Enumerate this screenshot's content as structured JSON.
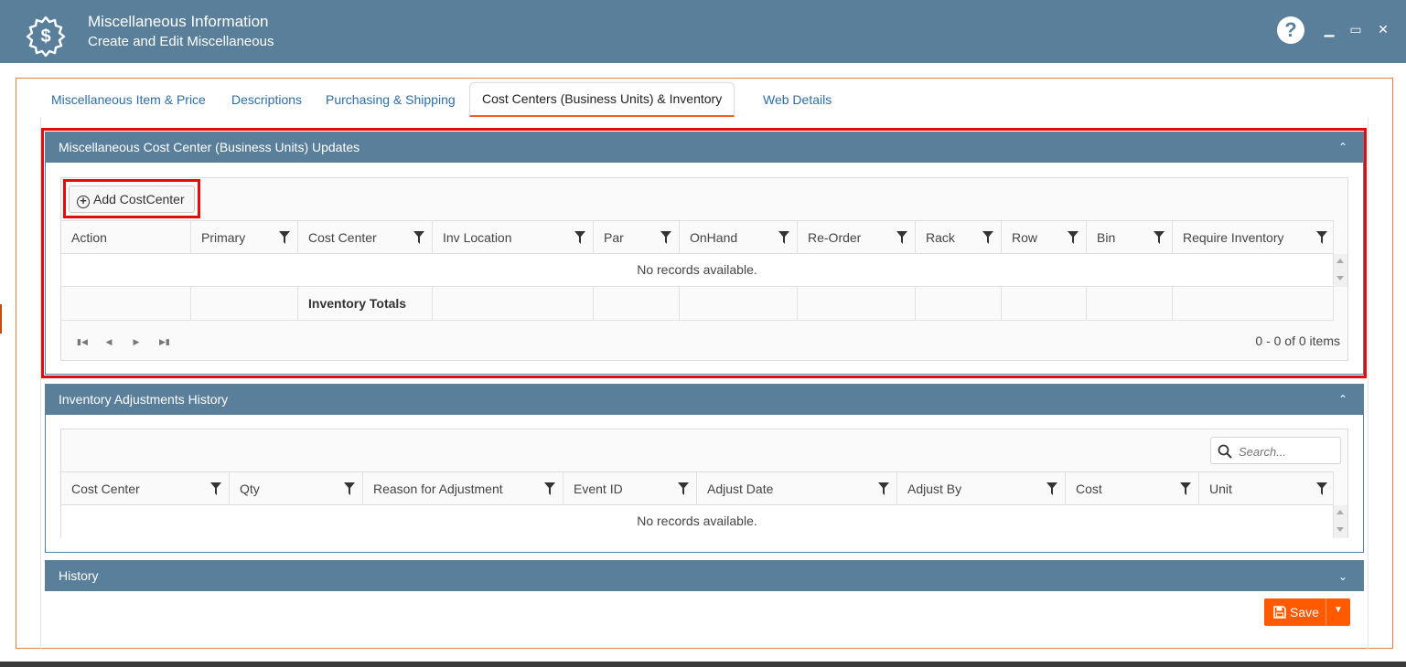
{
  "window": {
    "title": "Miscellaneous Information",
    "subtitle": "Create and Edit Miscellaneous",
    "help_label": "?",
    "minimize_label": "▁",
    "maximize_label": "▭",
    "close_label": "✕"
  },
  "tabs": [
    {
      "label": "Miscellaneous Item & Price",
      "active": false
    },
    {
      "label": "Descriptions",
      "active": false
    },
    {
      "label": "Purchasing & Shipping",
      "active": false
    },
    {
      "label": "Cost Centers (Business Units) & Inventory",
      "active": true
    },
    {
      "label": "Web Details",
      "active": false
    }
  ],
  "cost_center_panel": {
    "title": "Miscellaneous Cost Center (Business Units) Updates",
    "add_button_label": "Add CostCenter",
    "columns": [
      "Action",
      "Primary",
      "Cost Center",
      "Inv Location",
      "Par",
      "OnHand",
      "Re-Order",
      "Rack",
      "Row",
      "Bin",
      "Require Inventory"
    ],
    "no_records": "No records available.",
    "totals_label": "Inventory Totals",
    "pager_info": "0 - 0 of 0 items"
  },
  "adjustments_panel": {
    "title": "Inventory Adjustments History",
    "search_placeholder": "Search...",
    "columns": [
      "Cost Center",
      "Qty",
      "Reason for Adjustment",
      "Event ID",
      "Adjust Date",
      "Adjust By",
      "Cost",
      "Unit"
    ],
    "no_records": "No records available."
  },
  "history_panel": {
    "title": "History"
  },
  "save_button": {
    "label": "Save"
  },
  "colors": {
    "header_blue": "#5a7f9b",
    "accent_orange": "#ff5a00",
    "highlight_red": "#e30b0b",
    "link_blue": "#2e6da4"
  }
}
